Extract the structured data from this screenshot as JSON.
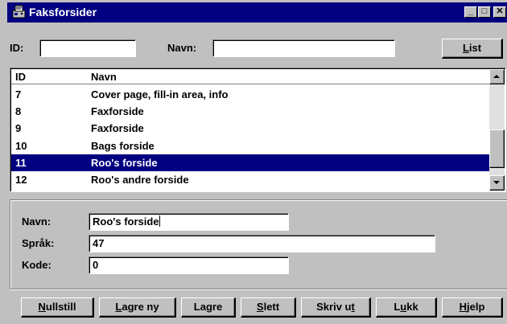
{
  "window": {
    "title": "Faksforsider",
    "app_icon": "fax-machine-icon",
    "controls": {
      "minimize": "_",
      "maximize": "□",
      "close": "✕"
    }
  },
  "search": {
    "id_label": "ID:",
    "id_value": "",
    "name_label": "Navn:",
    "name_value": "",
    "list_button": {
      "pre": "",
      "mnemonic": "L",
      "post": "ist"
    }
  },
  "list": {
    "headers": {
      "id": "ID",
      "name": "Navn"
    },
    "rows": [
      {
        "id": "7",
        "name": "Cover page, fill-in area, info",
        "selected": false
      },
      {
        "id": "8",
        "name": "Faxforside",
        "selected": false
      },
      {
        "id": "9",
        "name": "Faxforside",
        "selected": false
      },
      {
        "id": "10",
        "name": "Bags forside",
        "selected": false
      },
      {
        "id": "11",
        "name": "Roo's forside",
        "selected": true
      },
      {
        "id": "12",
        "name": "Roo's andre forside",
        "selected": false
      }
    ]
  },
  "detail": {
    "name_label": "Navn:",
    "name_value": "Roo's forside",
    "language_label": "Språk:",
    "language_value": "47",
    "code_label": "Kode:",
    "code_value": "0"
  },
  "buttons": [
    {
      "key": "reset",
      "pre": "",
      "mnemonic": "N",
      "post": "ullstill"
    },
    {
      "key": "save-new",
      "pre": "",
      "mnemonic": "L",
      "post": "agre ny"
    },
    {
      "key": "save",
      "pre": "La",
      "mnemonic": "g",
      "post": "re"
    },
    {
      "key": "delete",
      "pre": "",
      "mnemonic": "S",
      "post": "lett"
    },
    {
      "key": "print",
      "pre": "Skriv u",
      "mnemonic": "t",
      "post": ""
    },
    {
      "key": "close",
      "pre": "L",
      "mnemonic": "u",
      "post": "kk"
    },
    {
      "key": "help",
      "pre": "",
      "mnemonic": "H",
      "post": "jelp"
    }
  ],
  "colors": {
    "titlebar": "#000080",
    "selection": "#000080",
    "face": "#c0c0c0"
  }
}
